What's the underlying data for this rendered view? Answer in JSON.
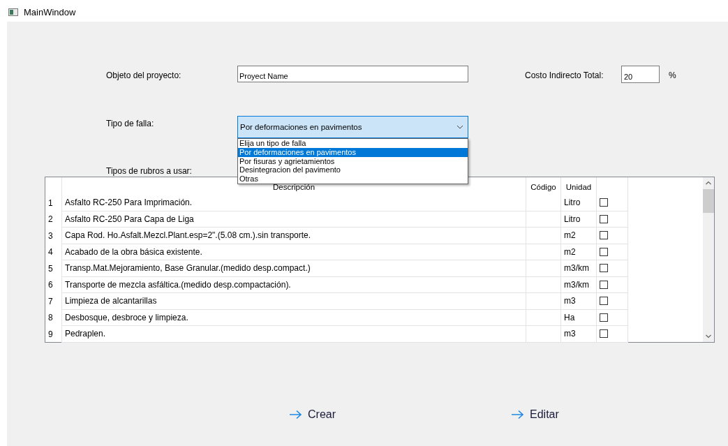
{
  "window": {
    "title": "MainWindow"
  },
  "project_object": {
    "label": "Objeto del proyecto:",
    "value": "Proyect Name"
  },
  "indirect_cost": {
    "label": "Costo Indirecto Total:",
    "value": "20",
    "unit": "%"
  },
  "failure_type": {
    "label": "Tipo de falla:",
    "value": "Por deformaciones en pavimentos",
    "expanded": true,
    "options": [
      {
        "label": "Elija un tipo de falla",
        "selected": false
      },
      {
        "label": "Por deformaciones en pavimentos",
        "selected": true
      },
      {
        "label": "Por fisuras y agrietamientos",
        "selected": false
      },
      {
        "label": "Desintegracion del pavimento",
        "selected": false
      },
      {
        "label": "Otras",
        "selected": false
      }
    ]
  },
  "items_label": "Tipos de rubros a usar:",
  "table": {
    "columns": [
      "Descripción",
      "Código",
      "Unidad"
    ],
    "rows": [
      {
        "number": "1",
        "description": "Asfalto RC-250 Para Imprimación.",
        "unit": "Litro",
        "checked": false
      },
      {
        "number": "2",
        "description": "Asfalto RC-250 Para Capa de Liga",
        "unit": "Litro",
        "checked": false
      },
      {
        "number": "3",
        "description": "Capa Rod. Ho.Asfalt.Mezcl.Plant.esp=2\".(5.08 cm.).sin transporte.",
        "unit": "m2",
        "checked": false
      },
      {
        "number": "4",
        "description": "Acabado de la obra básica existente.",
        "unit": "m2",
        "checked": false
      },
      {
        "number": "5",
        "description": "Transp.Mat.Mejoramiento, Base Granular.(medido desp.compact.)",
        "unit": "m3/km",
        "checked": false
      },
      {
        "number": "6",
        "description": "Transporte de mezcla asfáltica.(medido desp.compactación).",
        "unit": "m3/km",
        "checked": false
      },
      {
        "number": "7",
        "description": "Limpieza de alcantarillas",
        "unit": "m3",
        "checked": false
      },
      {
        "number": "8",
        "description": "Desbosque, desbroce y limpieza.",
        "unit": "Ha",
        "checked": false
      },
      {
        "number": "9",
        "description": "Pedraplen.",
        "unit": "m3",
        "checked": false
      }
    ]
  },
  "buttons": [
    {
      "label": "Crear"
    },
    {
      "label": "Editar"
    }
  ]
}
